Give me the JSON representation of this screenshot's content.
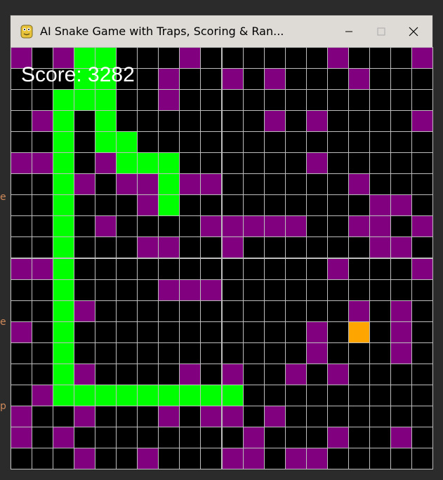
{
  "window": {
    "title": "AI Snake Game with Traps, Scoring & Ran...",
    "icon": "python-snake-icon"
  },
  "score_label": "Score: 3282",
  "grid": {
    "cols": 20,
    "rows": 20
  },
  "colors": {
    "empty": "#000000",
    "grid_line": "#bdbdbd",
    "snake": "#00ff00",
    "trap": "#800080",
    "food": "#ffa500",
    "score_text": "#ffffff"
  },
  "snake": [
    [
      3,
      0
    ],
    [
      4,
      0
    ],
    [
      3,
      1
    ],
    [
      4,
      1
    ],
    [
      2,
      2
    ],
    [
      3,
      2
    ],
    [
      4,
      2
    ],
    [
      2,
      3
    ],
    [
      4,
      3
    ],
    [
      2,
      4
    ],
    [
      4,
      4
    ],
    [
      5,
      4
    ],
    [
      2,
      5
    ],
    [
      5,
      5
    ],
    [
      6,
      5
    ],
    [
      7,
      5
    ],
    [
      2,
      6
    ],
    [
      7,
      6
    ],
    [
      2,
      7
    ],
    [
      7,
      7
    ],
    [
      2,
      8
    ],
    [
      2,
      9
    ],
    [
      2,
      10
    ],
    [
      2,
      11
    ],
    [
      2,
      12
    ],
    [
      2,
      13
    ],
    [
      2,
      14
    ],
    [
      2,
      15
    ],
    [
      2,
      16
    ],
    [
      3,
      16
    ],
    [
      4,
      16
    ],
    [
      5,
      16
    ],
    [
      6,
      16
    ],
    [
      7,
      16
    ],
    [
      8,
      16
    ],
    [
      9,
      16
    ],
    [
      10,
      16
    ]
  ],
  "food": [
    [
      16,
      13
    ]
  ],
  "traps": [
    [
      0,
      0
    ],
    [
      2,
      0
    ],
    [
      8,
      0
    ],
    [
      15,
      0
    ],
    [
      19,
      0
    ],
    [
      7,
      1
    ],
    [
      10,
      1
    ],
    [
      12,
      1
    ],
    [
      16,
      1
    ],
    [
      7,
      2
    ],
    [
      1,
      3
    ],
    [
      12,
      3
    ],
    [
      14,
      3
    ],
    [
      19,
      3
    ],
    [
      0,
      5
    ],
    [
      1,
      5
    ],
    [
      4,
      5
    ],
    [
      14,
      5
    ],
    [
      3,
      6
    ],
    [
      5,
      6
    ],
    [
      6,
      6
    ],
    [
      8,
      6
    ],
    [
      9,
      6
    ],
    [
      16,
      6
    ],
    [
      6,
      7
    ],
    [
      17,
      7
    ],
    [
      18,
      7
    ],
    [
      4,
      8
    ],
    [
      9,
      8
    ],
    [
      10,
      8
    ],
    [
      11,
      8
    ],
    [
      12,
      8
    ],
    [
      13,
      8
    ],
    [
      16,
      8
    ],
    [
      17,
      8
    ],
    [
      19,
      8
    ],
    [
      6,
      9
    ],
    [
      7,
      9
    ],
    [
      10,
      9
    ],
    [
      17,
      9
    ],
    [
      18,
      9
    ],
    [
      0,
      10
    ],
    [
      1,
      10
    ],
    [
      15,
      10
    ],
    [
      19,
      10
    ],
    [
      7,
      11
    ],
    [
      8,
      11
    ],
    [
      9,
      11
    ],
    [
      3,
      12
    ],
    [
      16,
      12
    ],
    [
      18,
      12
    ],
    [
      0,
      13
    ],
    [
      14,
      13
    ],
    [
      18,
      13
    ],
    [
      14,
      14
    ],
    [
      18,
      14
    ],
    [
      3,
      15
    ],
    [
      8,
      15
    ],
    [
      10,
      15
    ],
    [
      13,
      15
    ],
    [
      15,
      15
    ],
    [
      1,
      16
    ],
    [
      0,
      17
    ],
    [
      3,
      17
    ],
    [
      7,
      17
    ],
    [
      9,
      17
    ],
    [
      10,
      17
    ],
    [
      12,
      17
    ],
    [
      0,
      18
    ],
    [
      2,
      18
    ],
    [
      11,
      18
    ],
    [
      15,
      18
    ],
    [
      18,
      18
    ],
    [
      3,
      19
    ],
    [
      6,
      19
    ],
    [
      10,
      19
    ],
    [
      11,
      19
    ],
    [
      13,
      19
    ],
    [
      14,
      19
    ]
  ]
}
